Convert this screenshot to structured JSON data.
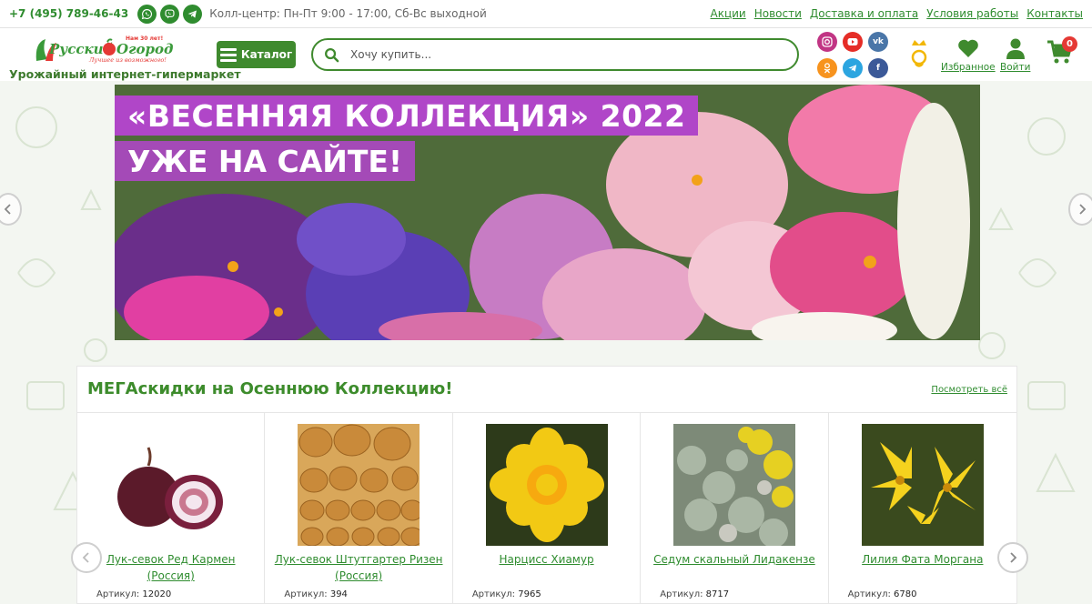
{
  "topbar": {
    "phone": "+7 (495) 789-46-43",
    "callcenter": "Колл-центр: Пн-Пт 9:00 - 17:00, Сб-Вс выходной",
    "links": [
      "Акции",
      "Новости",
      "Доставка и оплата",
      "Условия работы",
      "Контакты"
    ],
    "messengers": [
      "whatsapp-icon",
      "viber-icon",
      "telegram-icon"
    ]
  },
  "header": {
    "logo_text": "Русский Огород",
    "logo_badge": "Нам 30 лет!",
    "logo_slogan": "Лучшее из возможного!",
    "tagline": "Урожайный интернет-гипермаркет",
    "catalog_label": "Каталог",
    "search_placeholder": "Хочу купить...",
    "social": [
      {
        "icon": "instagram-icon",
        "color": "#c13584"
      },
      {
        "icon": "youtube-icon",
        "color": "#e52d27"
      },
      {
        "icon": "vk-icon",
        "color": "#4a76a8"
      },
      {
        "icon": "odnoklassniki-icon",
        "color": "#f7931e"
      },
      {
        "icon": "telegram-icon",
        "color": "#2ca5e0"
      },
      {
        "icon": "facebook-icon",
        "color": "#3b5998"
      }
    ],
    "favorites_label": "Избранное",
    "login_label": "Войти",
    "cart_count": "0",
    "accent_color": "#3f8a2e"
  },
  "banner": {
    "title": "«ВЕСЕННЯЯ КОЛЛЕКЦИЯ» 2022",
    "subtitle": "УЖЕ НА САЙТЕ!"
  },
  "deals": {
    "title": "МЕГАскидки на Осеннюю Коллекцию!",
    "view_all": "Посмотреть всё",
    "sku_label": "Артикул:",
    "products": [
      {
        "name": "Лук-севок Ред Кармен (Россия)",
        "sku": "12020"
      },
      {
        "name": "Лук-севок Штутгартер Ризен (Россия)",
        "sku": "394"
      },
      {
        "name": "Нарцисс Хиамур",
        "sku": "7965"
      },
      {
        "name": "Седум скальный Лидакензе",
        "sku": "8717"
      },
      {
        "name": "Лилия Фата Моргана",
        "sku": "6780"
      }
    ]
  }
}
